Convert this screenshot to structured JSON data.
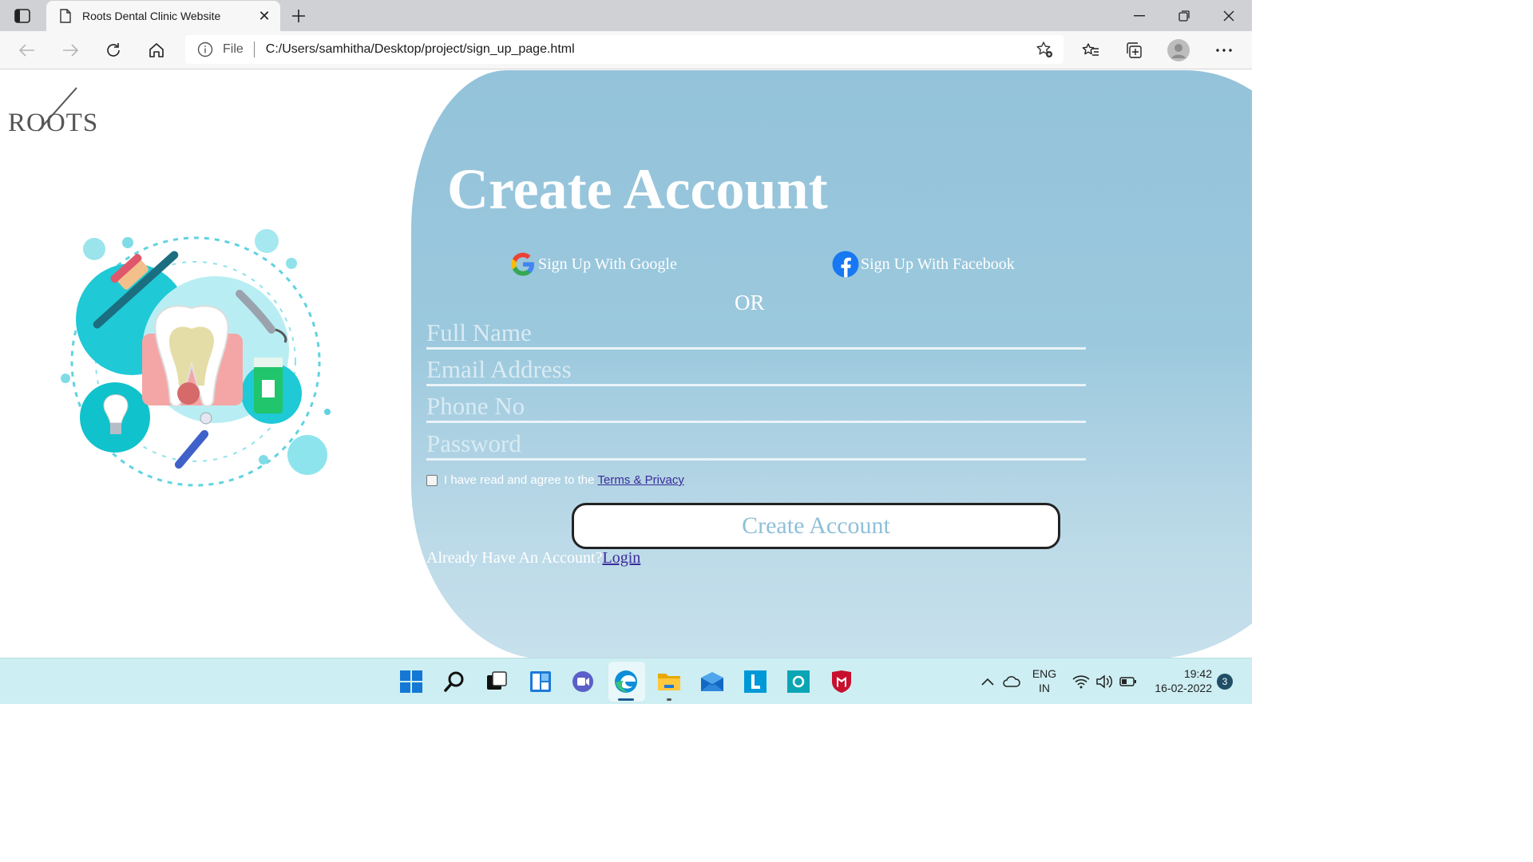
{
  "browser": {
    "tab_title": "Roots Dental Clinic Website",
    "tab_close": "✕",
    "address_scheme": "File",
    "address_url": "C:/Users/samhitha/Desktop/project/sign_up_page.html"
  },
  "page": {
    "logo_text": "ROOTS",
    "heading": "Create Account",
    "google_label": "Sign Up With Google",
    "facebook_label": "Sign Up With Facebook",
    "or_label": "OR",
    "fields": {
      "full_name_placeholder": "Full Name",
      "email_placeholder": "Email Address",
      "phone_placeholder": "Phone No",
      "password_placeholder": "Password"
    },
    "agree_text": "I have read and agree to the",
    "terms_link": "Terms & Privacy",
    "create_button": "Create Account",
    "already_text": "Already Have An Account?",
    "login_link": "Login"
  },
  "taskbar": {
    "language_line1": "ENG",
    "language_line2": "IN",
    "time": "19:42",
    "date": "16-02-2022",
    "notification_count": "3",
    "icons": [
      "windows-start-icon",
      "search-icon",
      "task-view-icon",
      "widgets-icon",
      "chat-icon",
      "edge-icon",
      "file-explorer-icon",
      "mail-icon",
      "l-app-icon",
      "o-app-icon",
      "mcafee-icon"
    ]
  },
  "colors": {
    "panel": "#93c3da",
    "link": "#3a2a9a",
    "taskbar": "#cdeef2"
  }
}
